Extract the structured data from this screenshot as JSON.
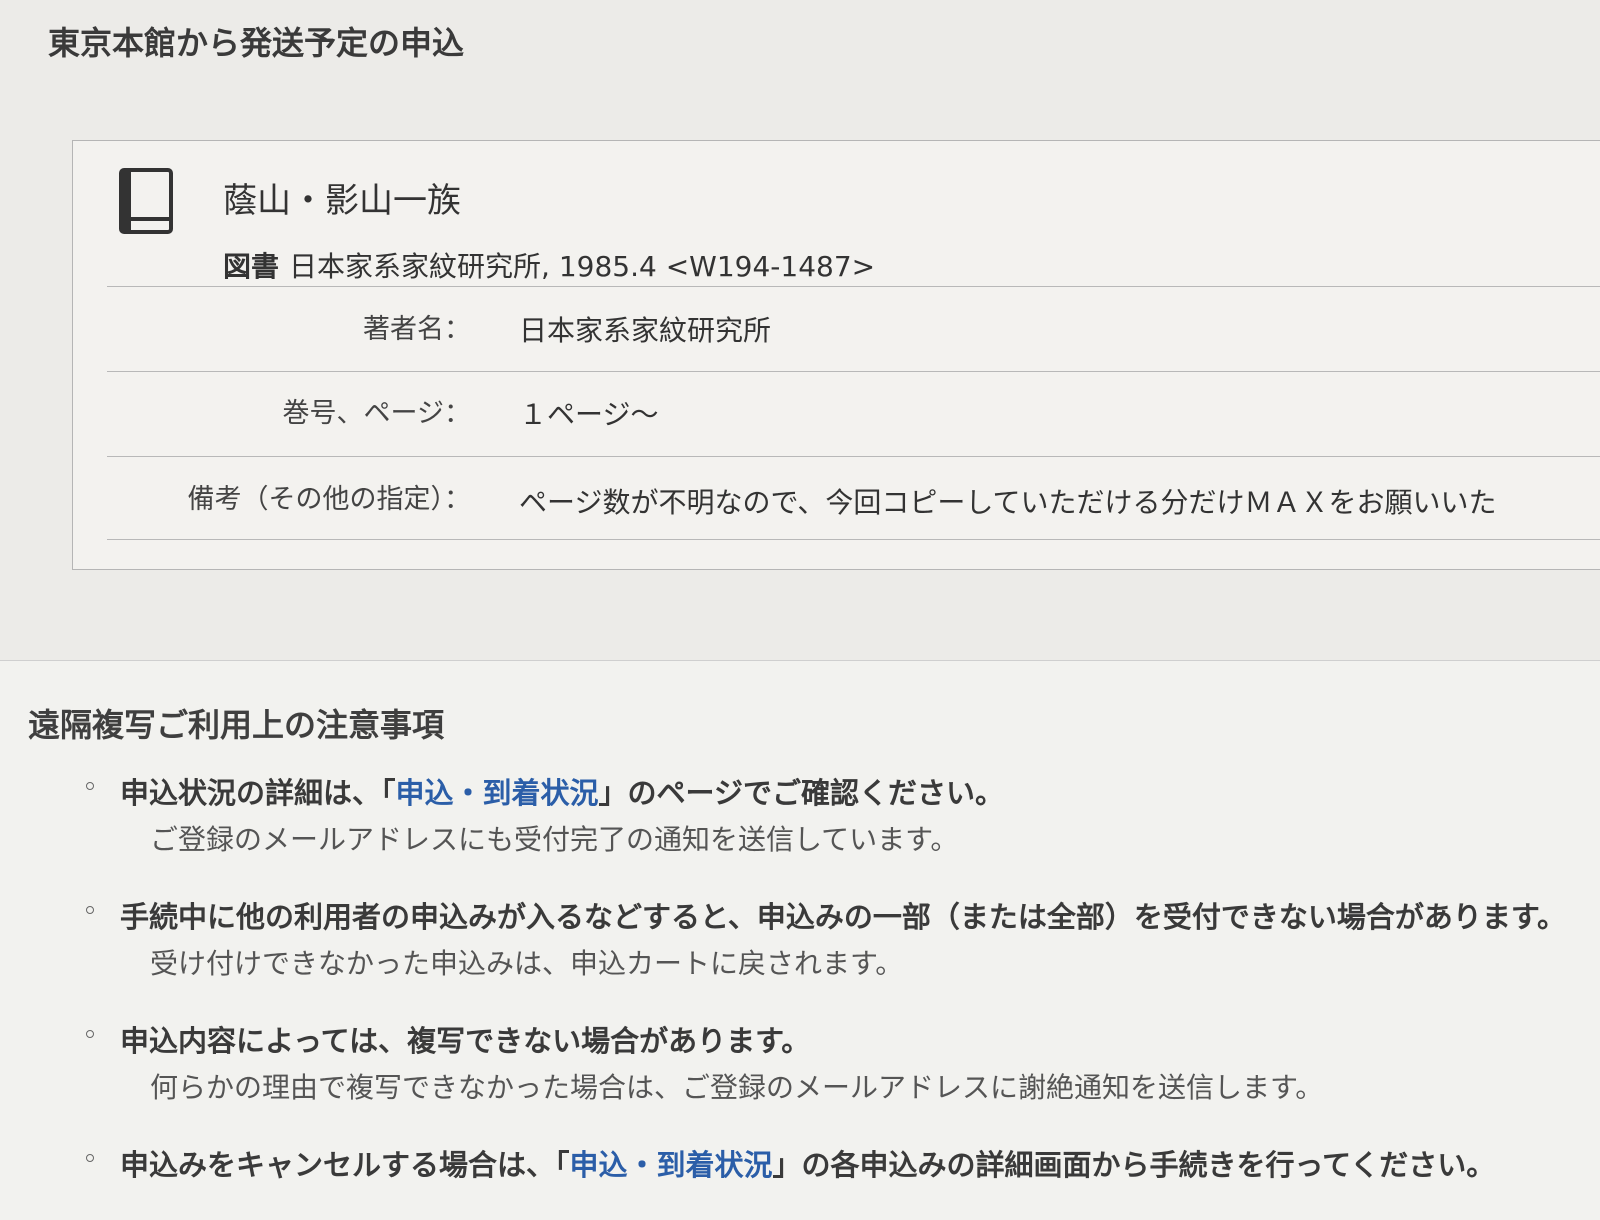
{
  "section_title": "東京本館から発送予定の申込",
  "item": {
    "icon": "book-icon",
    "title": "蔭山・影山一族",
    "type": "図書",
    "publisher_info": "日本家系家紋研究所, 1985.4 <W194-1487>",
    "fields": [
      {
        "label": "著者名：",
        "value": "日本家系家紋研究所"
      },
      {
        "label": "巻号、ページ：",
        "value": "１ページ〜"
      },
      {
        "label": "備考（その他の指定）：",
        "value": "ページ数が不明なので、今回コピーしていただける分だけＭＡＸをお願いいた"
      }
    ]
  },
  "notes": {
    "title": "遠隔複写ご利用上の注意事項",
    "items": [
      {
        "pre": "申込状況の詳細は、「",
        "link": "申込・到着状況",
        "post": "」のページでご確認ください。",
        "sub": "ご登録のメールアドレスにも受付完了の通知を送信しています。"
      },
      {
        "pre": "手続中に他の利用者の申込みが入るなどすると、申込みの一部（または全部）を受付できない場合があります。",
        "link": "",
        "post": "",
        "sub": "受け付けできなかった申込みは、申込カートに戻されます。"
      },
      {
        "pre": "申込内容によっては、複写できない場合があります。",
        "link": "",
        "post": "",
        "sub": "何らかの理由で複写できなかった場合は、ご登録のメールアドレスに謝絶通知を送信します。"
      },
      {
        "pre": "申込みをキャンセルする場合は、「",
        "link": "申込・到着状況",
        "post": "」の各申込みの詳細画面から手続きを行ってください。",
        "sub": ""
      }
    ]
  }
}
